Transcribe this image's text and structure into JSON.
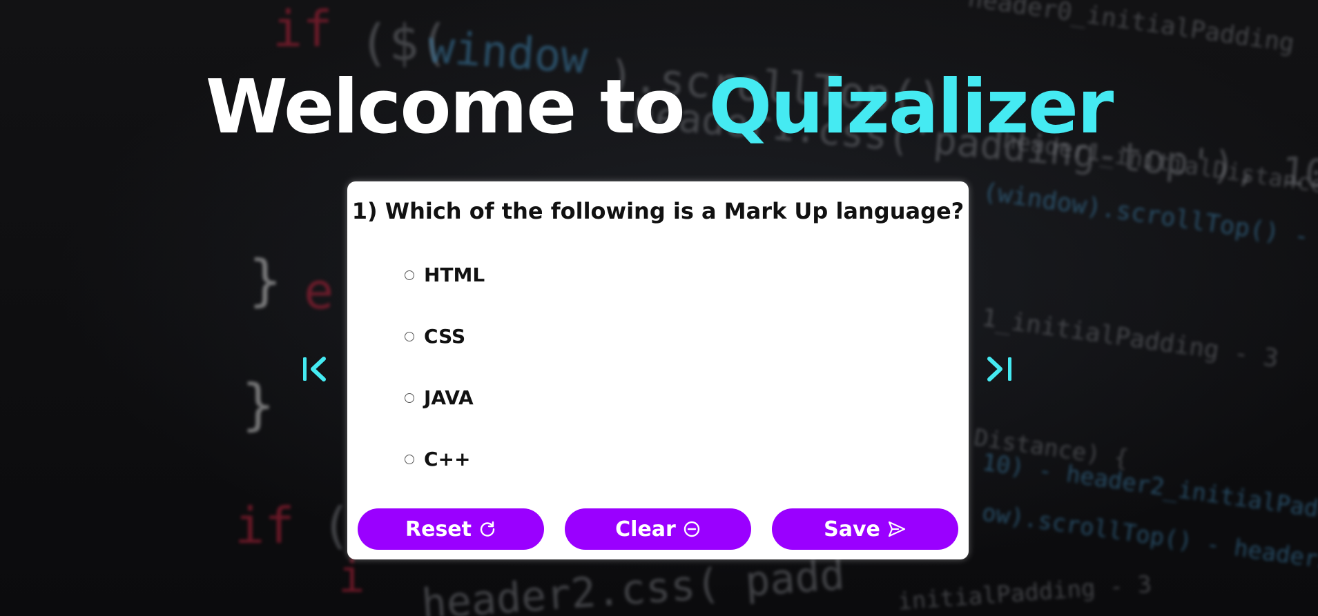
{
  "header": {
    "title_prefix": "Welcome to",
    "title_brand": "Quizalizer"
  },
  "quiz": {
    "question": "1) Which of the following is a Mark Up language?",
    "options": [
      {
        "label": "HTML"
      },
      {
        "label": "CSS"
      },
      {
        "label": "JAVA"
      },
      {
        "label": "C++"
      }
    ],
    "buttons": {
      "reset_label": "Reset",
      "clear_label": "Clear",
      "save_label": "Save"
    }
  },
  "icons": {
    "prev": "first-page-icon",
    "next": "last-page-icon",
    "reset": "refresh-icon",
    "clear": "minus-circle-icon",
    "save": "send-icon"
  },
  "colors": {
    "accent": "#45eaf2",
    "button": "#9a00ff",
    "card": "#ffffff"
  }
}
